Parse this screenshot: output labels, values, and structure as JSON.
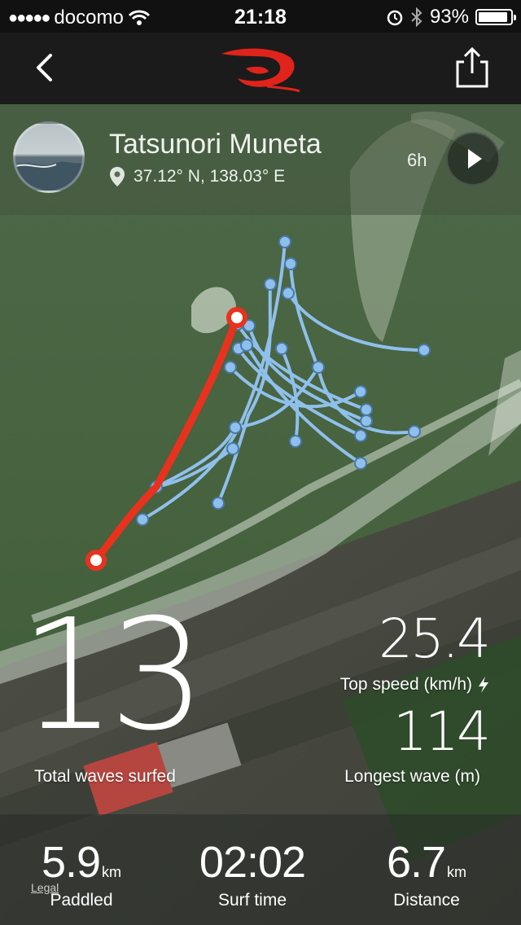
{
  "status_bar": {
    "carrier": "docomo",
    "time": "21:18",
    "battery": "93%",
    "battery_level": 0.93
  },
  "nav": {
    "brand": "Rip Curl"
  },
  "session": {
    "user_name": "Tatsunori Muneta",
    "coordinates": "37.12° N, 138.03° E",
    "duration": "6h"
  },
  "stats": {
    "total_waves": "13",
    "total_waves_label": "Total waves surfed",
    "top_speed": "25.4",
    "top_speed_label": "Top speed (km/h)",
    "longest_wave": "114",
    "longest_wave_label": "Longest wave (m)"
  },
  "summary": {
    "paddled_value": "5.9",
    "paddled_unit": "km",
    "paddled_label": "Paddled",
    "surf_time_value": "02:02",
    "surf_time_label": "Surf time",
    "distance_value": "6.7",
    "distance_unit": "km",
    "distance_label": "Distance"
  },
  "legal_link": "Legal",
  "colors": {
    "highlight_wave": "#e8321e",
    "wave_track": "#8fc0ec",
    "panel": "#1b1b1b"
  }
}
